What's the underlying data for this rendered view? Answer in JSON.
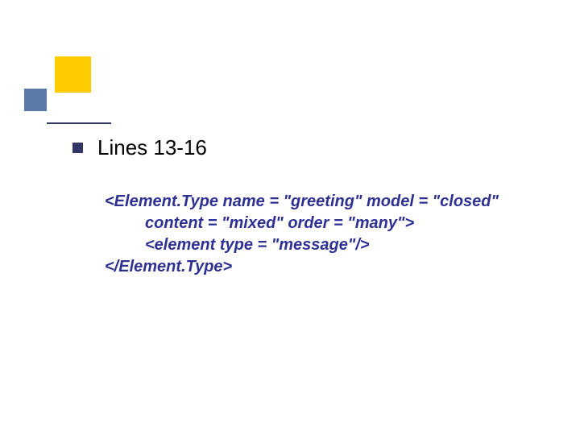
{
  "heading": "Lines 13-16",
  "code": {
    "line1": "<Element.Type name = \"greeting\" model = \"closed\"",
    "line2": "    content = \"mixed\" order = \"many\">",
    "line3": "    <element type = \"message\"/>",
    "line4": "</Element.Type>"
  }
}
